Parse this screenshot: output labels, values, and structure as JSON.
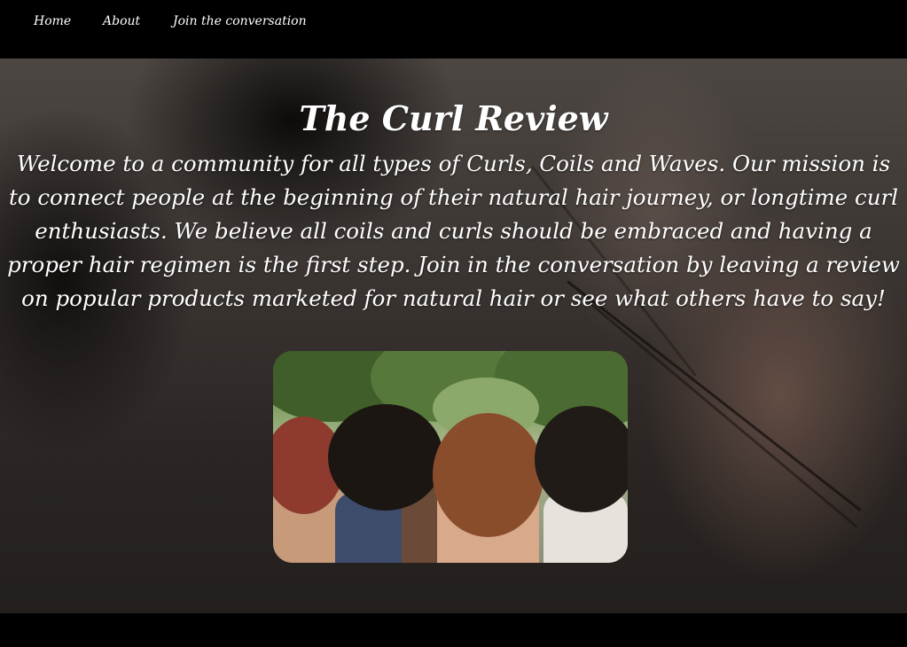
{
  "nav": {
    "items": [
      {
        "label": "Home"
      },
      {
        "label": "About"
      },
      {
        "label": "Join the conversation"
      }
    ]
  },
  "hero": {
    "title": "The Curl Review",
    "text": "Welcome to a community for all types of Curls, Coils and Waves. Our mission is to connect people at the beginning of their natural hair journey, or longtime curl enthusiasts. We believe all coils and curls should be embraced and having a proper hair regimen is the first step. Join in the conversation by leaving a review on popular products marketed for natural hair or see what others have to say!"
  },
  "colors": {
    "nav_background": "#000000",
    "text": "#ffffff"
  },
  "images": {
    "background": "curly-hair-background-photo",
    "feature": "group-of-women-natural-hair-photo"
  }
}
